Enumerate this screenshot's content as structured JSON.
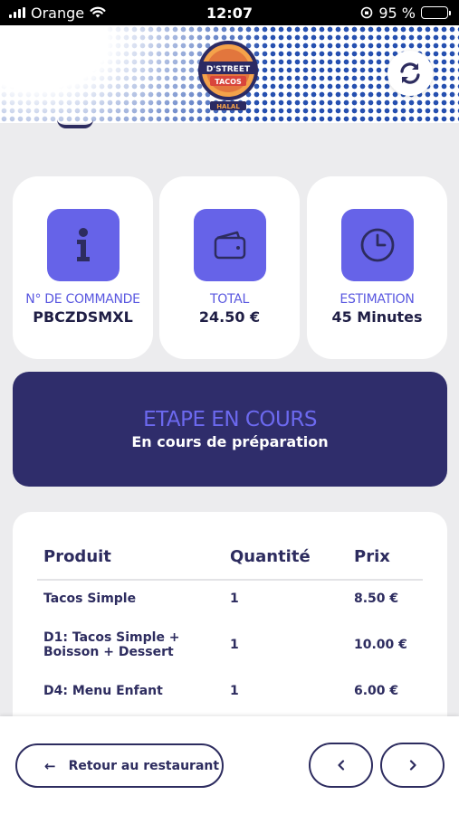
{
  "status_bar": {
    "carrier": "Orange",
    "time": "12:07",
    "battery": "95 %",
    "battery_level": 0.95
  },
  "header": {
    "logo_text": "D'STREET",
    "logo_sub": "TACOS",
    "logo_badge": "HALAL",
    "refresh_icon": "refresh-icon"
  },
  "info_cards": [
    {
      "icon": "info-icon",
      "label": "N° DE COMMANDE",
      "value": "PBCZDSMXL"
    },
    {
      "icon": "wallet-icon",
      "label": "TOTAL",
      "value": "24.50 €"
    },
    {
      "icon": "clock-icon",
      "label": "ESTIMATION",
      "value": "45 Minutes"
    }
  ],
  "step": {
    "title": "ETAPE EN COURS",
    "status": "En cours de préparation"
  },
  "order": {
    "columns": [
      "Produit",
      "Quantité",
      "Prix"
    ],
    "rows": [
      {
        "product": "Tacos Simple",
        "qty": "1",
        "price": "8.50 €"
      },
      {
        "product": "D1: Tacos Simple + Boisson + Dessert",
        "qty": "1",
        "price": "10.00 €"
      },
      {
        "product": "D4: Menu Enfant",
        "qty": "1",
        "price": "6.00 €"
      }
    ]
  },
  "bottom": {
    "back_label": "Retour au restaurant",
    "prev_icon": "chevron-left-icon",
    "next_icon": "chevron-right-icon"
  },
  "colors": {
    "accent": "#6663e8",
    "navy": "#2f2d6b",
    "background": "#ececee"
  }
}
